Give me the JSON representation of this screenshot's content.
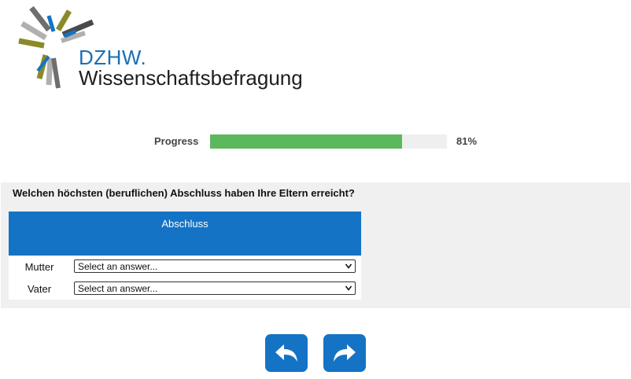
{
  "logo": {
    "acronym": "DZHW.",
    "name": "Wissenschaftsbefragung",
    "icon": "dzhw-logo-mark"
  },
  "progress": {
    "label": "Progress",
    "percent_text": "81%",
    "value": 0.81
  },
  "question": {
    "text": "Welchen höchsten (beruflichen) Abschluss haben Ihre Eltern erreicht?",
    "matrix": {
      "column_header": "Abschluss",
      "rows": [
        {
          "label": "Mutter",
          "select_value": "Select an answer..."
        },
        {
          "label": "Vater",
          "select_value": "Select an answer..."
        }
      ]
    }
  },
  "navigation": {
    "back_icon": "back-arrow-icon",
    "next_icon": "forward-arrow-icon"
  },
  "colors": {
    "brand_blue": "#1473c5",
    "progress_green": "#5cb85c",
    "panel_gray": "#f0f0f0"
  }
}
